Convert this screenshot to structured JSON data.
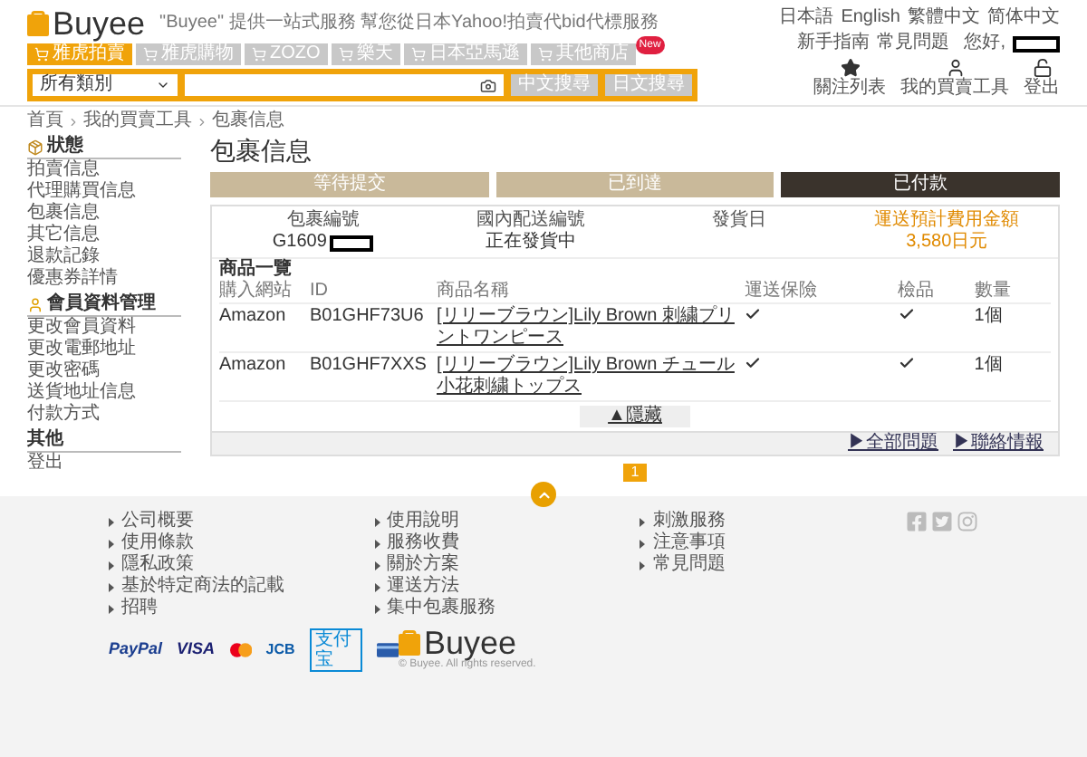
{
  "header": {
    "logo": "Buyee",
    "tagline": "\"Buyee\" 提供一站式服務 幫您從日本Yahoo!拍賣代bid代標服務",
    "languages": [
      "日本語",
      "English",
      "繁體中文",
      "简体中文"
    ],
    "help_links": [
      "新手指南",
      "常見問題"
    ],
    "greeting": "您好,",
    "nav_tabs": [
      {
        "label": "雅虎拍賣",
        "selected": true
      },
      {
        "label": "雅虎購物",
        "selected": false
      },
      {
        "label": "ZOZO",
        "selected": false
      },
      {
        "label": "樂天",
        "selected": false
      },
      {
        "label": "日本亞馬遜",
        "selected": false
      },
      {
        "label": "其他商店",
        "selected": false,
        "badge": "New"
      }
    ],
    "search": {
      "category": "所有類別",
      "buttons": [
        "中文搜尋",
        "日文搜尋"
      ]
    },
    "actions": [
      {
        "kind": "star",
        "label": "關注列表"
      },
      {
        "kind": "user",
        "label": "我的買賣工具"
      },
      {
        "kind": "logout",
        "label": "登出"
      }
    ]
  },
  "breadcrumb": [
    "首頁",
    "我的買賣工具",
    "包裹信息"
  ],
  "sidebar": [
    {
      "kind": "box",
      "title": "狀態",
      "items": [
        "拍賣信息",
        "代理購買信息",
        "包裹信息",
        "其它信息",
        "退款記錄",
        "優惠券詳情"
      ]
    },
    {
      "kind": "user",
      "title": "會員資料管理",
      "items": [
        "更改會員資料",
        "更改電郵地址",
        "更改密碼",
        "送貨地址信息",
        "付款方式"
      ]
    },
    {
      "kind": "none",
      "title": "其他",
      "items": [
        "登出"
      ]
    }
  ],
  "page_title": "包裹信息",
  "status_tabs": [
    {
      "label": "等待提交",
      "selected": false
    },
    {
      "label": "已到達",
      "selected": false
    },
    {
      "label": "已付款",
      "selected": true
    }
  ],
  "package": {
    "fields": [
      {
        "kind": "redacted",
        "label": "包裹編號",
        "value": "G1609"
      },
      {
        "kind": "plain",
        "label": "國內配送編號",
        "value": "正在發貨中"
      },
      {
        "kind": "plain",
        "label": "發貨日"
      },
      {
        "kind": "price",
        "label": "運送預計費用金額",
        "value": "3,580日元"
      }
    ],
    "items_title": "商品一覽",
    "columns": [
      "購入網站",
      "ID",
      "商品名稱",
      "運送保險",
      "檢品",
      "數量"
    ],
    "rows": [
      {
        "site": "Amazon",
        "id": "B01GHF73U6",
        "name": "[リリーブラウン]Lily Brown 刺繍プリントワンピース",
        "insured": true,
        "inspected": true,
        "qty": "1個"
      },
      {
        "site": "Amazon",
        "id": "B01GHF7XXS",
        "name": "[リリーブラウン]Lily Brown チュール小花刺繍トップス",
        "insured": true,
        "inspected": true,
        "qty": "1個"
      }
    ],
    "toggle": "▲隱藏",
    "footer_links": [
      "▶全部問題",
      "▶聯絡情報"
    ]
  },
  "pagination": [
    {
      "label": "1",
      "selected": true
    }
  ],
  "footer": {
    "columns": [
      [
        "公司概要",
        "使用條款",
        "隱私政策",
        "基於特定商法的記載",
        "招聘"
      ],
      [
        "使用說明",
        "服務收費",
        "關於方案",
        "運送方法",
        "集中包裹服務"
      ],
      [
        "刺激服務",
        "注意事項",
        "常見問題"
      ]
    ],
    "payments": [
      {
        "kind": "paypal",
        "label": "PayPal"
      },
      {
        "kind": "visa",
        "label": "VISA"
      },
      {
        "kind": "mastercard"
      },
      {
        "kind": "jcb",
        "label": "JCB"
      },
      {
        "kind": "alipay",
        "label": "支付宝"
      },
      {
        "kind": "card"
      }
    ],
    "logo": "Buyee",
    "copyright": "© Buyee. All rights reserved."
  }
}
